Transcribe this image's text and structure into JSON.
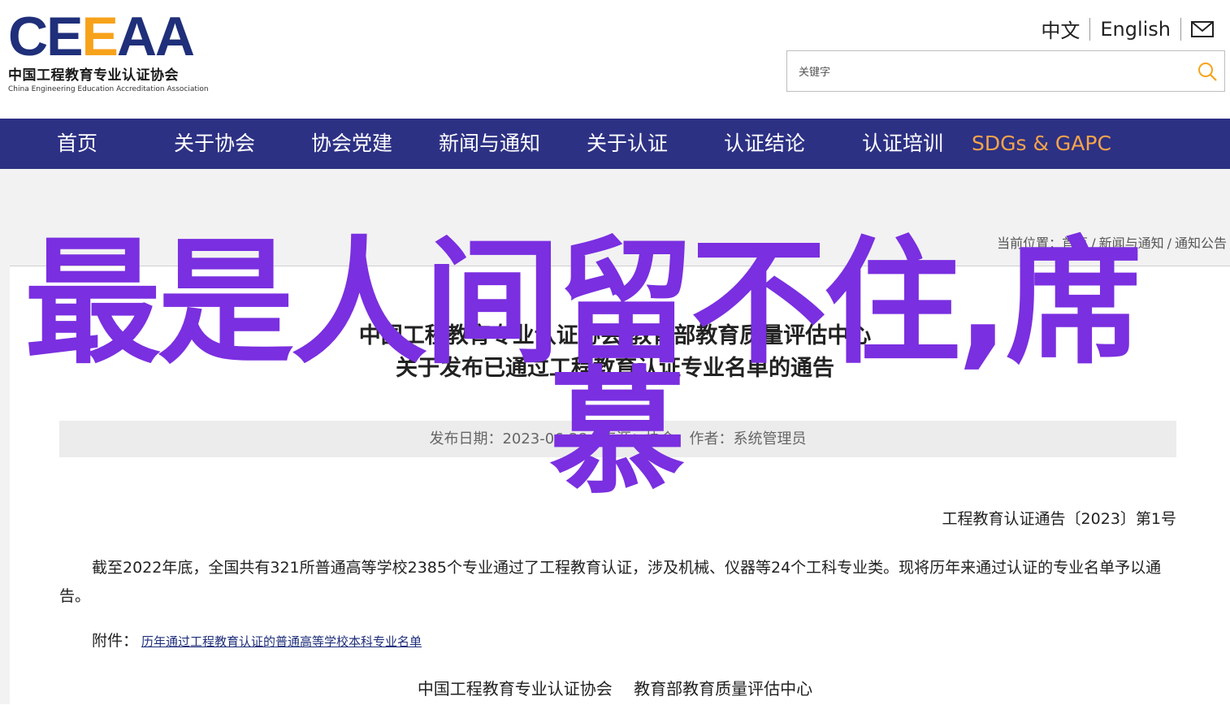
{
  "header": {
    "logo": {
      "mark": "CEEAA",
      "name_cn": "中国工程教育专业认证协会",
      "name_en": "China Engineering Education Accreditation Association"
    },
    "lang_cn": "中文",
    "lang_en": "English",
    "mail_icon": "mail-icon",
    "search": {
      "placeholder": "关键字",
      "icon": "search-icon"
    }
  },
  "nav": {
    "items": [
      {
        "label": "首页"
      },
      {
        "label": "关于协会"
      },
      {
        "label": "协会党建"
      },
      {
        "label": "新闻与通知"
      },
      {
        "label": "关于认证"
      },
      {
        "label": "认证结论"
      },
      {
        "label": "认证培训"
      },
      {
        "label": "SDGs & GAPC"
      }
    ],
    "accent_color": "#f7a44a",
    "bg_color": "#2d3184"
  },
  "breadcrumb": {
    "prefix": "当前位置：",
    "items": [
      "首页",
      "新闻与通知",
      "通知公告"
    ],
    "sep": "/"
  },
  "article": {
    "title_line1": "中国工程教育专业认证协会 教育部教育质量评估中心",
    "title_line2": "关于发布已通过工程教育认证专业名单的通告",
    "meta": {
      "date": "发布日期：2023-06-28",
      "source": "来源：协会",
      "author": "作者：系统管理员"
    },
    "notice_no": "工程教育认证通告〔2023〕第1号",
    "paragraph": "截至2022年底，全国共有321所普通高等学校2385个专业通过了工程教育认证，涉及机械、仪器等24个工科专业类。现将历年来通过认证的专业名单予以通告。",
    "attachment_label": "附件：",
    "attachment_link": "历年通过工程教育认证的普通高等学校本科专业名单",
    "sign1": "中国工程教育专业认证协会",
    "sign2": "教育部教育质量评估中心"
  },
  "overlay": {
    "line1": "最是人间留不住,席",
    "line2": "慕",
    "color": "#7a2fe0"
  }
}
